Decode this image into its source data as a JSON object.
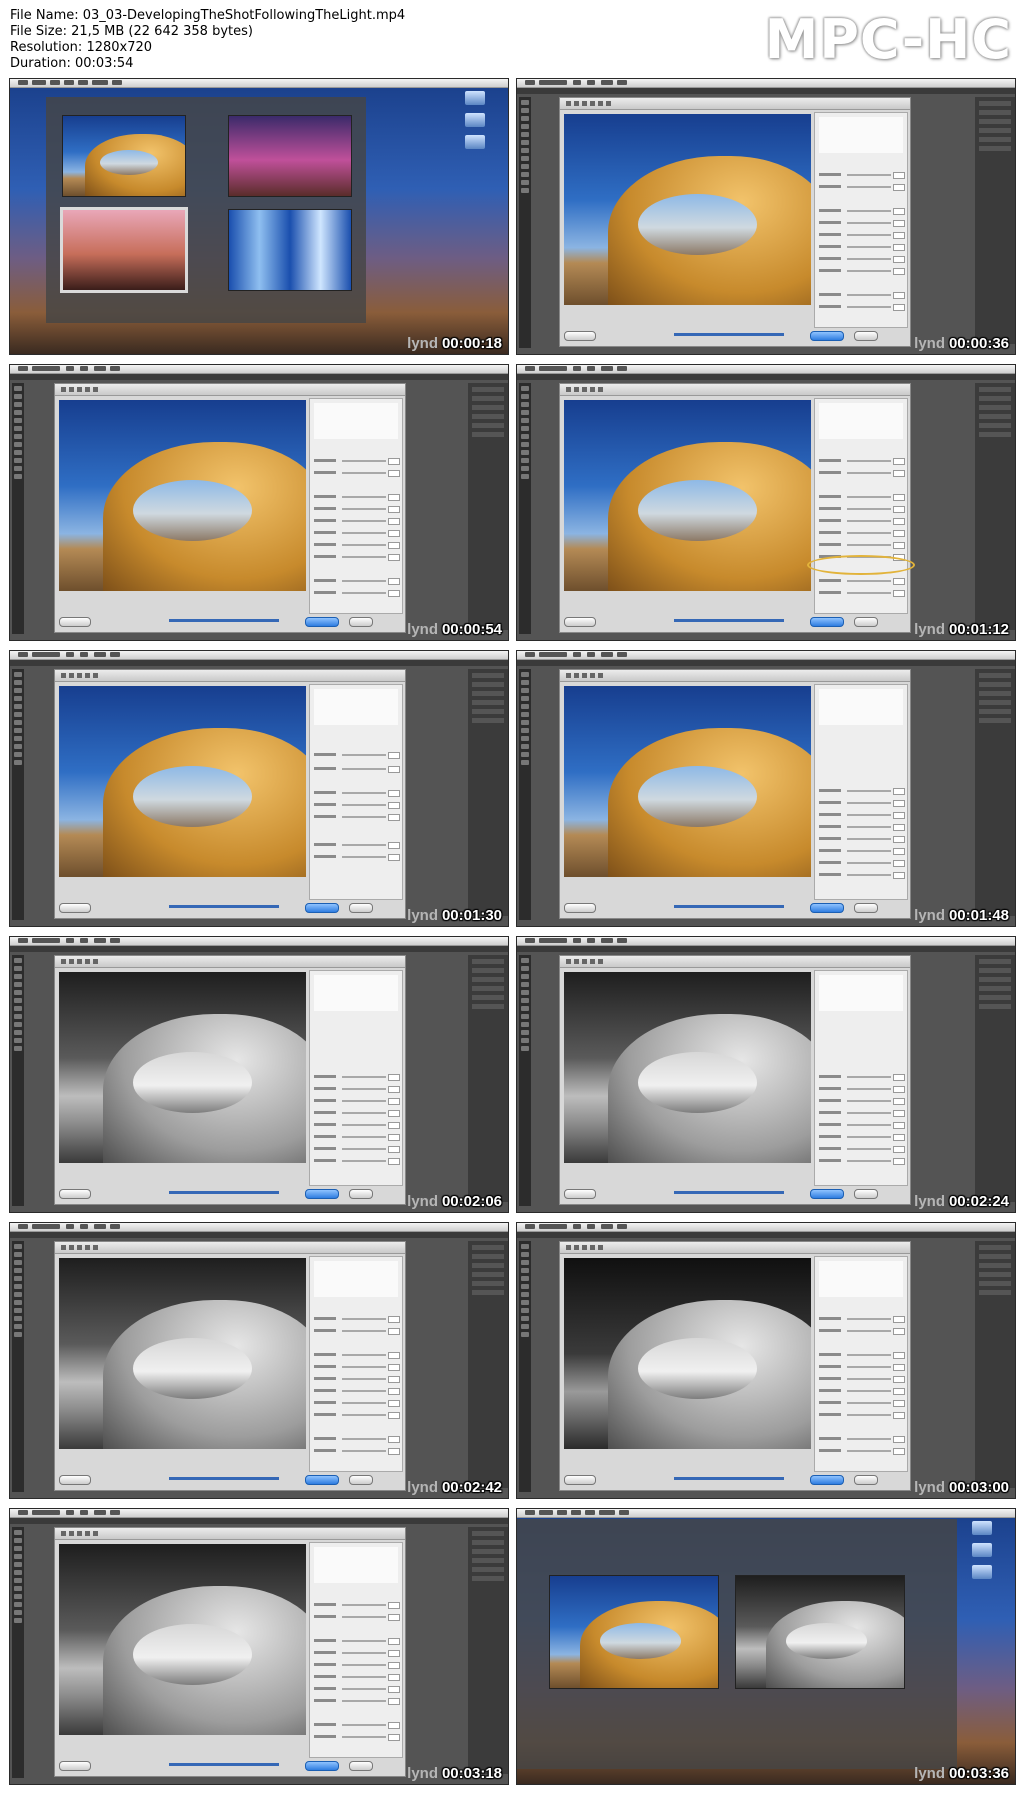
{
  "header": {
    "file_name": "File Name: 03_03-DevelopingTheShotFollowingTheLight.mp4",
    "file_size": "File Size: 21,5 MB (22 642 358 bytes)",
    "resolution": "Resolution: 1280x720",
    "duration": "Duration: 00:03:54",
    "brand": "MPC-HC"
  },
  "watermark": "lynd",
  "thumbnails": [
    {
      "time": "00:00:18",
      "scene": "finder-gallery"
    },
    {
      "time": "00:00:36",
      "scene": "camera-raw-color"
    },
    {
      "time": "00:00:54",
      "scene": "camera-raw-color"
    },
    {
      "time": "00:01:12",
      "scene": "camera-raw-color-highlight"
    },
    {
      "time": "00:01:30",
      "scene": "camera-raw-color"
    },
    {
      "time": "00:01:48",
      "scene": "camera-raw-color"
    },
    {
      "time": "00:02:06",
      "scene": "camera-raw-bw"
    },
    {
      "time": "00:02:24",
      "scene": "camera-raw-bw"
    },
    {
      "time": "00:02:42",
      "scene": "camera-raw-bw"
    },
    {
      "time": "00:03:00",
      "scene": "camera-raw-bw-dark"
    },
    {
      "time": "00:03:18",
      "scene": "camera-raw-bw"
    },
    {
      "time": "00:03:36",
      "scene": "finder-compare"
    }
  ],
  "colors": {
    "accent_blue": "#2f7de0",
    "highlight_yellow": "#e2b33a",
    "timestamp": "#ffffff"
  }
}
